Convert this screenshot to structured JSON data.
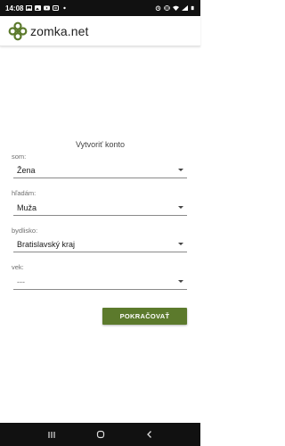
{
  "status_bar": {
    "time": "14:08",
    "icons_left": [
      "gallery-icon",
      "image-icon",
      "youtube-icon",
      "sync-icon",
      "dot-icon"
    ],
    "icons_right": [
      "alarm-icon",
      "vibrate-icon",
      "wifi-icon",
      "signal-icon",
      "battery-icon"
    ]
  },
  "app_bar": {
    "logo_icon": "clover-icon",
    "logo_text": "zomka.net",
    "brand_color": "#5c7a2c"
  },
  "form": {
    "title": "Vytvoriť konto",
    "fields": [
      {
        "label": "som:",
        "value": "Žena"
      },
      {
        "label": "hľadám:",
        "value": "Muža"
      },
      {
        "label": "bydlisko:",
        "value": "Bratislavský kraj"
      },
      {
        "label": "vek:",
        "value": "---"
      }
    ],
    "continue_label": "POKRAČOVAŤ"
  },
  "nav_bar": {
    "icons": [
      "recents-icon",
      "home-icon",
      "back-icon"
    ]
  }
}
